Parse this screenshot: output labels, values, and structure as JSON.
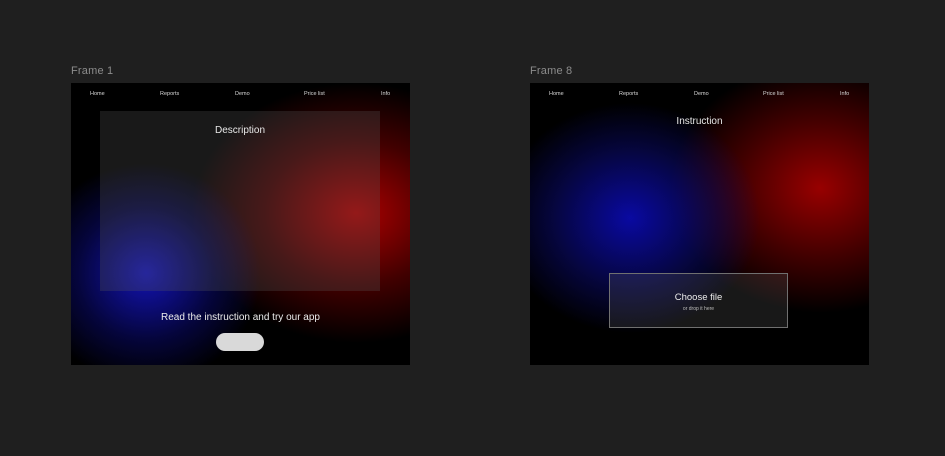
{
  "canvas": {
    "background": "#1f1f1f"
  },
  "frames": [
    {
      "label": "Frame 1",
      "nav": [
        "Home",
        "Reports",
        "Demo",
        "Price list",
        "Info"
      ],
      "panel_title": "Description",
      "cta_text": "Read the instruction and try our app",
      "button_label": ""
    },
    {
      "label": "Frame 8",
      "nav": [
        "Home",
        "Reports",
        "Demo",
        "Price list",
        "Info"
      ],
      "title": "Instruction",
      "dropzone": {
        "main": "Choose file",
        "sub": "or drop it here"
      }
    }
  ],
  "colors": {
    "frame_background": "#000000",
    "glow_red": "#b40000",
    "glow_blue": "#1414be",
    "button": "#d9d9d9",
    "label": "#8c8c8c"
  }
}
